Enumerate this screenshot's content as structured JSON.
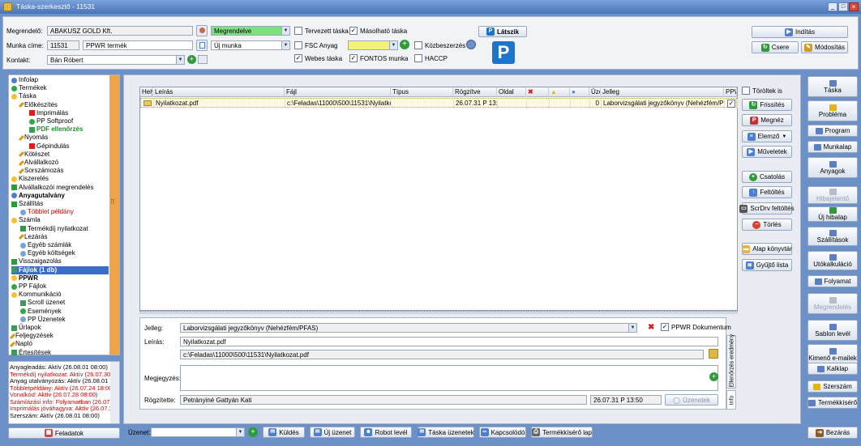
{
  "window": {
    "title": "Táska-szerkesztő - 11531"
  },
  "header": {
    "customer_label": "Megrendelő:",
    "customer_value": "ABAKUSZ GOLD Kft.",
    "status_value": "Megrendelve",
    "job_title_label": "Munka címe:",
    "job_number": "11531",
    "job_name": "PPWR termék",
    "job_type_value": "Új munka",
    "contact_label": "Kontakt:",
    "contact_value": "Bán Róbert",
    "cb_planned": "Tervezett táska",
    "cb_copyable": "Másolható táska",
    "cb_fsc": "FSC Anyag",
    "cb_public": "Közbeszerzés",
    "cb_web": "Webes táska",
    "cb_important": "FONTOS munka",
    "cb_haccp": "HACCP",
    "visible_btn": "Látszik",
    "start_btn": "Indítás",
    "swap_btn": "Csere",
    "modify_btn": "Módosítás"
  },
  "tree": [
    {
      "label": "Infolap",
      "level": 0,
      "icon": "info",
      "style": ""
    },
    {
      "label": "Termékek",
      "level": 0,
      "icon": "dot-green",
      "style": ""
    },
    {
      "label": "Táska",
      "level": 0,
      "icon": "dot-yellow",
      "style": ""
    },
    {
      "label": "Előkészítés",
      "level": 1,
      "icon": "pencil",
      "style": ""
    },
    {
      "label": "Imprimálás",
      "level": 2,
      "icon": "x-red",
      "style": ""
    },
    {
      "label": "PP Softproof",
      "level": 2,
      "icon": "dot-green",
      "style": ""
    },
    {
      "label": "PDF ellenőrzés",
      "level": 2,
      "icon": "doc",
      "style": "green"
    },
    {
      "label": "Nyomás",
      "level": 1,
      "icon": "pencil",
      "style": ""
    },
    {
      "label": "Gépindulás",
      "level": 2,
      "icon": "x-red",
      "style": ""
    },
    {
      "label": "Kötészet",
      "level": 1,
      "icon": "pencil",
      "style": ""
    },
    {
      "label": "Alvállalkozó",
      "level": 1,
      "icon": "pencil",
      "style": ""
    },
    {
      "label": "Sorszámozás",
      "level": 1,
      "icon": "pencil",
      "style": ""
    },
    {
      "label": "Kiszerelés",
      "level": 0,
      "icon": "dot-yellow",
      "style": ""
    },
    {
      "label": "Alvállalkozói megrendelés",
      "level": 0,
      "icon": "arrow",
      "style": ""
    },
    {
      "label": "Anyagutalvány",
      "level": 0,
      "icon": "info",
      "style": "bold"
    },
    {
      "label": "Szállítás",
      "level": 0,
      "icon": "arrow",
      "style": ""
    },
    {
      "label": "Többlet példány",
      "level": 1,
      "icon": "dot-blue",
      "style": "red"
    },
    {
      "label": "Számla",
      "level": 0,
      "icon": "dot-yellow",
      "style": ""
    },
    {
      "label": "Termékdíj nyilatkozat",
      "level": 1,
      "icon": "arrow",
      "style": ""
    },
    {
      "label": "Lezárás",
      "level": 1,
      "icon": "pencil",
      "style": ""
    },
    {
      "label": "Egyéb számlák",
      "level": 1,
      "icon": "dot-blue",
      "style": ""
    },
    {
      "label": "Egyéb költségek",
      "level": 1,
      "icon": "dot-blue",
      "style": ""
    },
    {
      "label": "Visszaigazolás",
      "level": 0,
      "icon": "arrow",
      "style": ""
    },
    {
      "label": "Fájlok (1 db)",
      "level": 0,
      "icon": "doc",
      "style": "selected"
    },
    {
      "label": "PPWR",
      "level": 0,
      "icon": "dot-yellow",
      "style": "bold"
    },
    {
      "label": "PP Fájlok",
      "level": 0,
      "icon": "dot-green",
      "style": ""
    },
    {
      "label": "Kommunikáció",
      "level": 0,
      "icon": "dot-yellow",
      "style": ""
    },
    {
      "label": "Scroll üzenet",
      "level": 1,
      "icon": "doc",
      "style": ""
    },
    {
      "label": "Események",
      "level": 1,
      "icon": "dot-green",
      "style": ""
    },
    {
      "label": "PP Üzenetek",
      "level": 1,
      "icon": "dot-blue",
      "style": ""
    },
    {
      "label": "Űrlapok",
      "level": 0,
      "icon": "doc",
      "style": ""
    },
    {
      "label": "Feljegyzések",
      "level": 0,
      "icon": "pencil",
      "style": ""
    },
    {
      "label": "Napló",
      "level": 0,
      "icon": "pencil",
      "style": ""
    },
    {
      "label": "Értesítések",
      "level": 0,
      "icon": "doc",
      "style": ""
    }
  ],
  "status_lines": [
    {
      "text": "Anyagleadás: Aktív (26.08.01 08:00)",
      "color": "#000000"
    },
    {
      "text": "Termékdíj nyilatkozat: Aktív (26.07.30 1",
      "color": "#d40000"
    },
    {
      "text": "Anyag utalványozás: Aktív (26.08.01 1",
      "color": "#000000"
    },
    {
      "text": "Többletpéldány: Aktív (26.07.24 18:00)",
      "color": "#d40000"
    },
    {
      "text": "Vonalkód: Aktív (26.07.28 08:00)",
      "color": "#d40000"
    },
    {
      "text": "Számlázási info: Folyamatban (26.07.3",
      "color": "#d40000"
    },
    {
      "text": "Imprimálás jóváhagyva: Aktív (26.07.3",
      "color": "#d40000"
    },
    {
      "text": "Szerszám: Aktív (26.08.01 08:00)",
      "color": "#000000"
    }
  ],
  "tasks_btn": "Feladatok",
  "grid": {
    "columns": [
      "Hely",
      "Leírás",
      "Fájl",
      "Típus",
      "Rögzítve",
      "Oldal",
      "",
      "",
      "",
      "Üze",
      "Jelleg",
      "PPW"
    ],
    "rows": [
      {
        "description": "Nyilatkozat.pdf",
        "file": "c:\\Feladas\\11000\\500\\11531\\Nyilatkozat.",
        "type": "",
        "recorded": "26.07.31 P 13:5",
        "pages": "",
        "msg": "0",
        "kind": "Laborvizsgálati jegyzőkönyv (Nehézfém/PFAS)",
        "ppwr": "✓"
      }
    ]
  },
  "mid_buttons": {
    "deleted_too": "Töröltek is",
    "refresh": "Frissítés",
    "open": "Megnéz",
    "editor": "Elemző",
    "operations": "Műveletek",
    "attach": "Csatolás",
    "upload": "Feltöltés",
    "scrdrv": "ScrDrv feltöltés",
    "delete": "Törlés",
    "base_dir": "Alap könyvtár",
    "collect_list": "Gyűjtő lista"
  },
  "detail": {
    "kind_label": "Jelleg:",
    "kind_value": "Laborvizsgálati jegyzőkönyv (Nehézfém/PFAS)",
    "ppwr_doc": "PPWR Dokumentum",
    "desc_label": "Leírás:",
    "desc_value": "Nyilatkozat.pdf",
    "path_value": "c:\\Feladas\\11000\\500\\11531\\Nyilatkozat.pdf",
    "note_label": "Megjegyzés:",
    "recorded_label": "Rögzítette:",
    "recorded_by": "Petrányiné Gattyán Kati",
    "recorded_at": "26.07.31 P 13:50",
    "messages_btn": "Üzenetek",
    "tab_check": "Ellenőrzés eredmény",
    "tab_info": "Info"
  },
  "right_buttons": [
    {
      "label": "Táska",
      "icon": "#5b7fc4",
      "disabled": false
    },
    {
      "label": "Probléma",
      "icon": "#e8b400",
      "disabled": false
    },
    {
      "label": "Program",
      "icon": "#5b7fc4",
      "disabled": false
    },
    {
      "label": "Munkalap",
      "icon": "#5b7fc4",
      "disabled": false
    },
    {
      "label": "Anyagok",
      "icon": "#5b7fc4",
      "disabled": false
    },
    {
      "label": "Hibajelentő",
      "icon": "#b5bccb",
      "disabled": true
    },
    {
      "label": "Új hibalap",
      "icon": "#2f9a3a",
      "disabled": false
    },
    {
      "label": "Szállítások",
      "icon": "#5b7fc4",
      "disabled": false
    },
    {
      "label": "Utókalkuláció",
      "icon": "#5b7fc4",
      "disabled": false
    },
    {
      "label": "Folyamat",
      "icon": "#5b7fc4",
      "disabled": false
    },
    {
      "label": "Megrendelés",
      "icon": "#b5bccb",
      "disabled": true
    },
    {
      "label": "Sablon levél",
      "icon": "#5b7fc4",
      "disabled": false
    },
    {
      "label": "Kimenő e-mailek",
      "icon": "#5b7fc4",
      "disabled": false
    },
    {
      "label": "Kalklap",
      "icon": "#5b7fc4",
      "disabled": false
    },
    {
      "label": "Szerszám",
      "icon": "#e8b400",
      "disabled": false
    },
    {
      "label": "Termékkísérő",
      "icon": "#5b7fc4",
      "disabled": false
    }
  ],
  "close_btn": "Bezárás",
  "bottom": {
    "message_label": "Üzenet:",
    "send": "Küldés",
    "new_message": "Új üzenet",
    "robot_letter": "Robot levél",
    "job_messages": "Táska üzenetek",
    "connected": "Kapcsolódó",
    "product_sheet": "Termékkísérő lap"
  }
}
